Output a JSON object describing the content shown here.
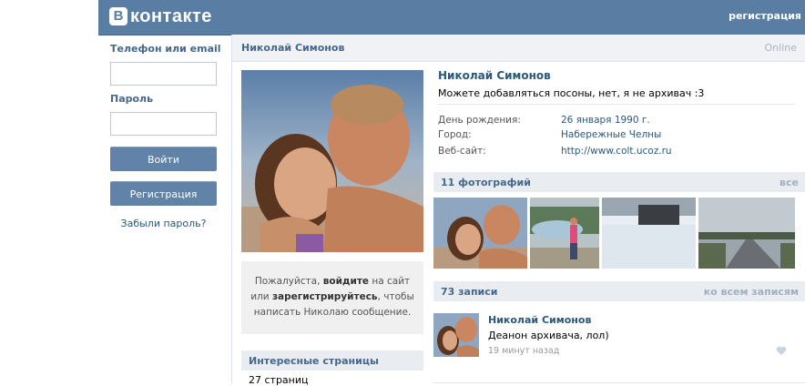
{
  "header": {
    "logo_letter": "В",
    "logo_text": "контакте",
    "register_link": "регистрация"
  },
  "login": {
    "phone_label": "Телефон или email",
    "password_label": "Пароль",
    "login_button": "Войти",
    "register_button": "Регистрация",
    "forgot_link": "Забыли пароль?"
  },
  "profile": {
    "header_name": "Николай Симонов",
    "online": "Online",
    "name": "Николай Симонов",
    "status": "Можете добавляться посоны, нет, я не архивач :3",
    "info": [
      {
        "label": "День рождения:",
        "value": "26 января 1990 г."
      },
      {
        "label": "Город:",
        "value": "Набережные Челны"
      },
      {
        "label": "Веб-сайт:",
        "value": "http://www.colt.ucoz.ru"
      }
    ]
  },
  "message_box": {
    "pre": "Пожалуйста, ",
    "login_link": "войдите",
    "mid": " на сайт или ",
    "register_link": "зарегистрируйтесь",
    "post": ", чтобы написать Николаю сообщение."
  },
  "interesting_pages": {
    "title": "Интересные страницы",
    "count": "27 страниц"
  },
  "photos": {
    "title": "11 фотографий",
    "all_link": "все"
  },
  "wall": {
    "title": "73 записи",
    "all_link": "ко всем записям",
    "post": {
      "author": "Николай Симонов",
      "text": "Деанон архивача, лол)",
      "time": "19 минут назад"
    }
  },
  "colors": {
    "header_bg": "#597da3",
    "link": "#2b587a",
    "button": "#6283a8"
  },
  "icons": [
    "vk-logo-icon",
    "heart-icon"
  ]
}
